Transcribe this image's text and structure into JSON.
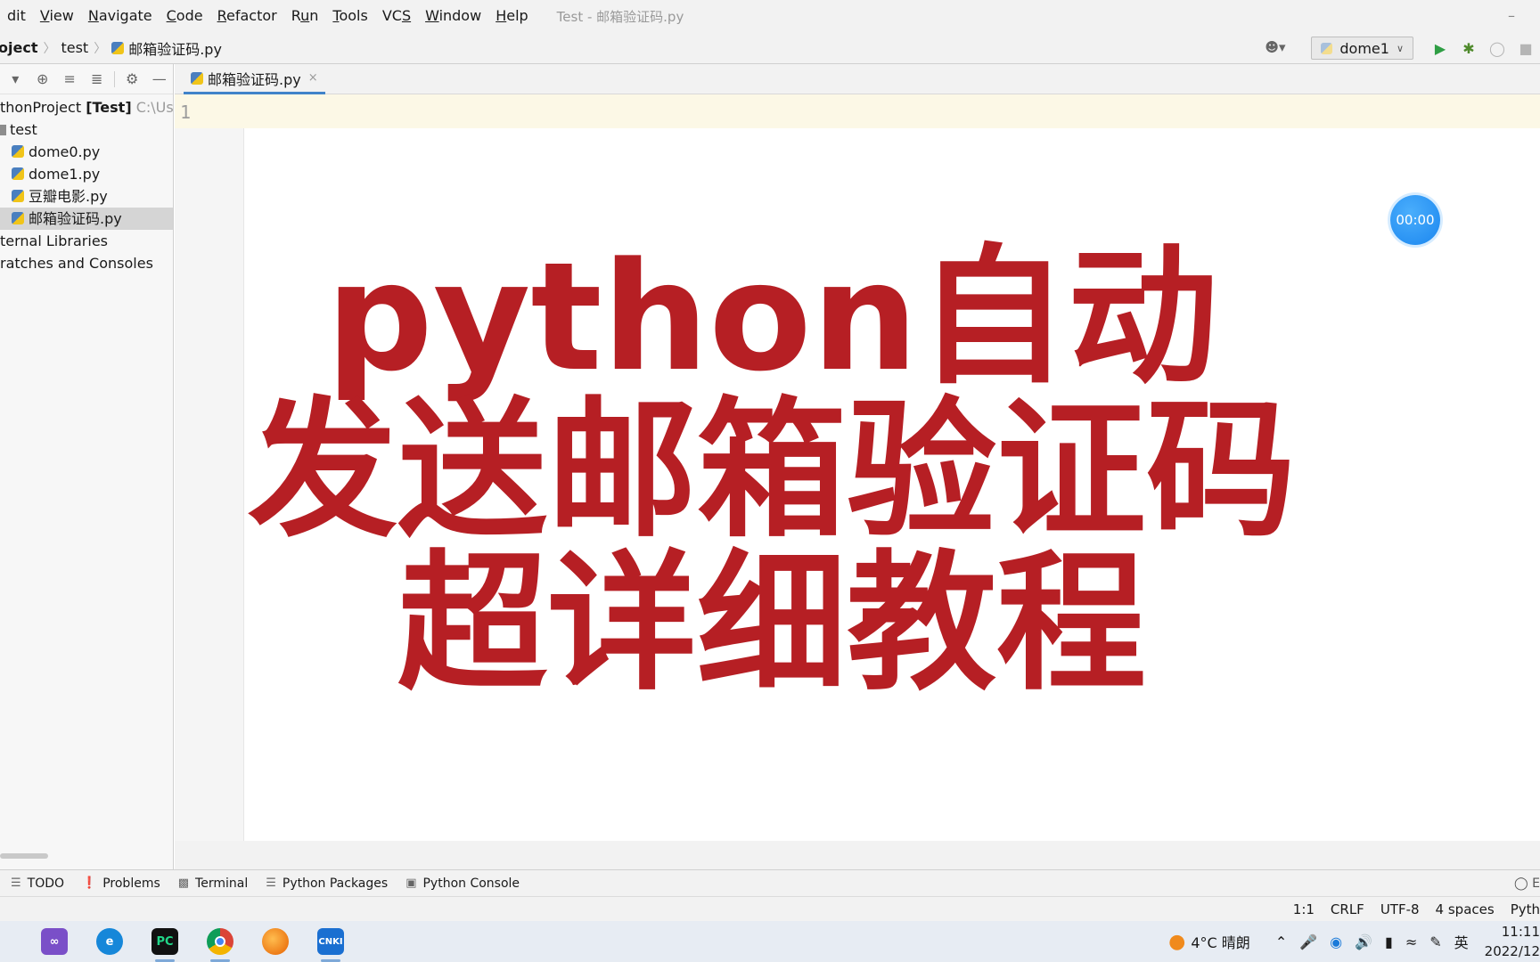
{
  "menubar": {
    "items": [
      {
        "prefix": "",
        "underline": "",
        "rest": "dit"
      },
      {
        "prefix": "",
        "underline": "V",
        "rest": "iew"
      },
      {
        "prefix": "",
        "underline": "N",
        "rest": "avigate"
      },
      {
        "prefix": "",
        "underline": "C",
        "rest": "ode"
      },
      {
        "prefix": "",
        "underline": "R",
        "rest": "efactor"
      },
      {
        "prefix": "R",
        "underline": "u",
        "rest": "n"
      },
      {
        "prefix": "",
        "underline": "T",
        "rest": "ools"
      },
      {
        "prefix": "VC",
        "underline": "S",
        "rest": ""
      },
      {
        "prefix": "",
        "underline": "W",
        "rest": "indow"
      },
      {
        "prefix": "",
        "underline": "H",
        "rest": "elp"
      }
    ],
    "window_title": "Test - 邮箱验证码.py",
    "minimize_glyph": "–"
  },
  "navbar": {
    "crumbs": [
      "oject",
      "test",
      "邮箱验证码.py"
    ],
    "run_config": "dome1"
  },
  "project": {
    "root_name": "thonProject",
    "root_module": "[Test]",
    "root_path": "C:\\User",
    "folder": "test",
    "files": [
      "dome0.py",
      "dome1.py",
      "豆瓣电影.py",
      "邮箱验证码.py"
    ],
    "selected_file_index": 3,
    "libraries": "ternal Libraries",
    "scratches": "ratches and Consoles"
  },
  "editor": {
    "tab_label": "邮箱验证码.py",
    "tab_close": "×",
    "line_number": "1"
  },
  "timer": "00:00",
  "overlay": {
    "line1": "python自动",
    "line2": "发送邮箱验证码",
    "line3": "超详细教程",
    "color": "#b61f24"
  },
  "toolwindows": {
    "items": [
      "TODO",
      "Problems",
      "Terminal",
      "Python Packages",
      "Python Console"
    ],
    "search": "◯ E"
  },
  "status": {
    "position": "1:1",
    "line_sep": "CRLF",
    "encoding": "UTF-8",
    "indent": "4 spaces",
    "interpreter": "Pyth"
  },
  "taskbar": {
    "apps": [
      "visual-studio-icon",
      "edge-icon",
      "pycharm-icon",
      "chrome-icon",
      "firefox-icon",
      "cnki-icon"
    ],
    "pycharm_text": "PC",
    "cnki_text": "CNKI",
    "weather": "4°C  晴朗",
    "ime": "英",
    "time": "11:11",
    "date": "2022/12"
  }
}
